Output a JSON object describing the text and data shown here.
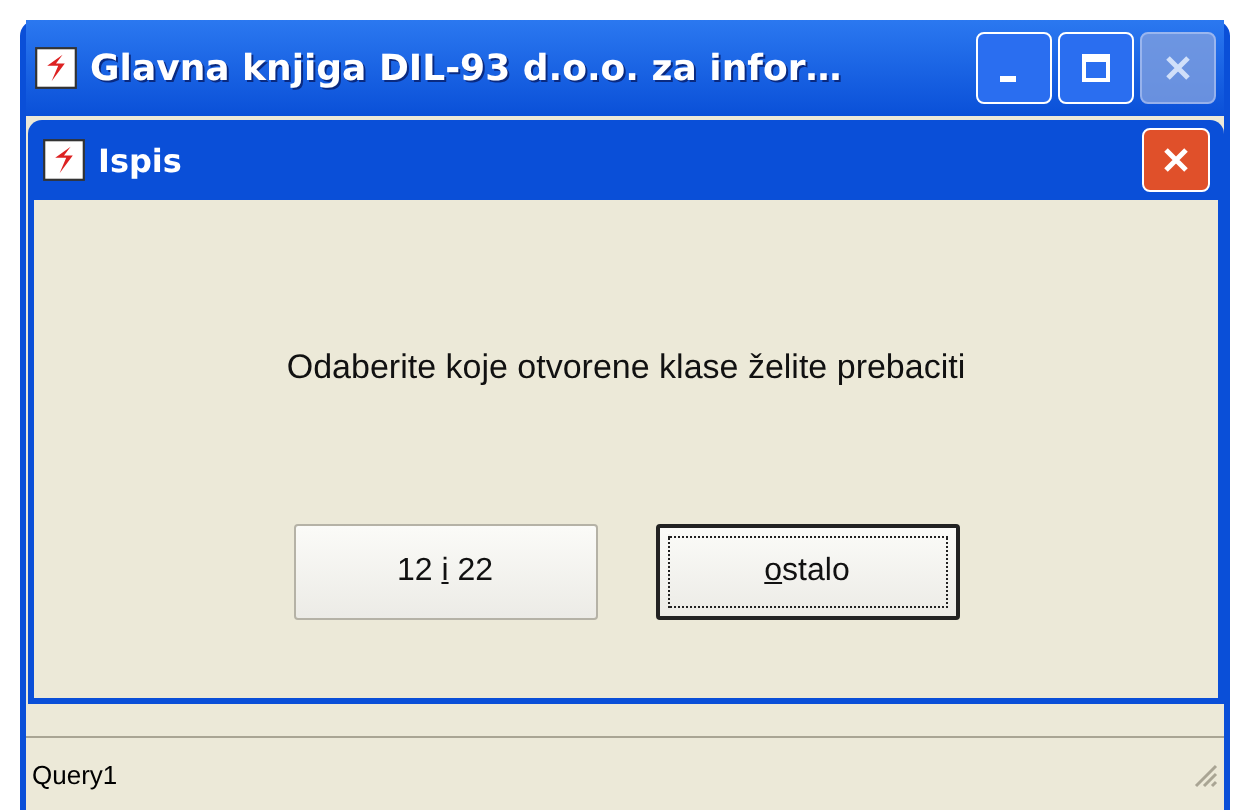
{
  "main_window": {
    "title": "Glavna knjiga DIL-93 d.o.o. za infor…",
    "close_disabled": true
  },
  "dialog": {
    "title": "Ispis",
    "message": "Odaberite koje otvorene klase želite prebaciti",
    "buttons": [
      {
        "before": "12 ",
        "access_key": "i",
        "after": " 22",
        "focused": false
      },
      {
        "access_key": "o",
        "after": "stalo",
        "focused": true
      }
    ]
  },
  "status_bar": {
    "text": "Query1"
  }
}
